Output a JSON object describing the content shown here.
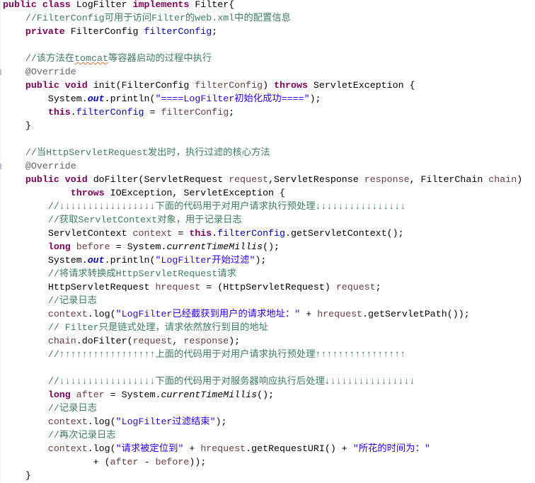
{
  "code": {
    "lines": [
      [
        [
          "public class ",
          "k"
        ],
        [
          "LogFilter ",
          "p"
        ],
        [
          "implements ",
          "k"
        ],
        [
          "Filter{",
          "p"
        ]
      ],
      [
        [
          "    ",
          "p"
        ],
        [
          "//FilterConfig可用于访问Filter的web.xml中的配置信息",
          "c"
        ]
      ],
      [
        [
          "    ",
          "p"
        ],
        [
          "private ",
          "k"
        ],
        [
          "FilterConfig ",
          "p"
        ],
        [
          "filterConfig",
          "f"
        ],
        [
          ";",
          "p"
        ]
      ],
      [],
      [
        [
          "    ",
          "p"
        ],
        [
          "//该方法在",
          "c"
        ],
        [
          "tomcat",
          "cu"
        ],
        [
          "等容器启动的过程中执行",
          "c"
        ]
      ],
      [
        [
          "    ",
          "p"
        ],
        [
          "@Override",
          "a"
        ]
      ],
      [
        [
          "    ",
          "p"
        ],
        [
          "public void ",
          "k"
        ],
        [
          "init(FilterConfig ",
          "p"
        ],
        [
          "filterConfig",
          "v"
        ],
        [
          ") ",
          "p"
        ],
        [
          "throws ",
          "k"
        ],
        [
          "ServletException {",
          "p"
        ]
      ],
      [
        [
          "        System.",
          "p"
        ],
        [
          "out",
          "o"
        ],
        [
          ".println(",
          "p"
        ],
        [
          "\"====LogFilter初始化成功====\"",
          "s"
        ],
        [
          ");",
          "p"
        ]
      ],
      [
        [
          "        ",
          "p"
        ],
        [
          "this",
          "k"
        ],
        [
          ".",
          "p"
        ],
        [
          "filterConfig",
          "f"
        ],
        [
          " = ",
          "p"
        ],
        [
          "filterConfig",
          "v"
        ],
        [
          ";",
          "p"
        ]
      ],
      [
        [
          "    }",
          "p"
        ]
      ],
      [],
      [
        [
          "    ",
          "p"
        ],
        [
          "//当HttpServletRequest发出时，执行过滤的核心方法",
          "c"
        ]
      ],
      [
        [
          "    ",
          "p"
        ],
        [
          "@Override",
          "a"
        ]
      ],
      [
        [
          "    ",
          "p"
        ],
        [
          "public void ",
          "k"
        ],
        [
          "doFilter(ServletRequest ",
          "p"
        ],
        [
          "request",
          "v"
        ],
        [
          ",ServletResponse ",
          "p"
        ],
        [
          "response",
          "v"
        ],
        [
          ", FilterChain ",
          "p"
        ],
        [
          "chain",
          "v"
        ],
        [
          ")",
          "p"
        ]
      ],
      [
        [
          "            ",
          "p"
        ],
        [
          "throws ",
          "k"
        ],
        [
          "IOException, ServletException {",
          "p"
        ]
      ],
      [
        [
          "        ",
          "p"
        ],
        [
          "//↓↓↓↓↓↓↓↓↓↓↓↓↓↓↓↓↓下面的代码用于对用户请求执行预处理↓↓↓↓↓↓↓↓↓↓↓↓↓↓↓↓",
          "c"
        ]
      ],
      [
        [
          "        ",
          "p"
        ],
        [
          "//获取ServletContext对象，用于记录日志",
          "c"
        ]
      ],
      [
        [
          "        ServletContext ",
          "p"
        ],
        [
          "context",
          "v"
        ],
        [
          " = ",
          "p"
        ],
        [
          "this",
          "k"
        ],
        [
          ".",
          "p"
        ],
        [
          "filterConfig",
          "f"
        ],
        [
          ".getServletContext();",
          "p"
        ]
      ],
      [
        [
          "        ",
          "p"
        ],
        [
          "long ",
          "k"
        ],
        [
          "before",
          "v"
        ],
        [
          " = System.",
          "p"
        ],
        [
          "currentTimeMillis",
          "i"
        ],
        [
          "();",
          "p"
        ]
      ],
      [
        [
          "        System.",
          "p"
        ],
        [
          "out",
          "o"
        ],
        [
          ".println(",
          "p"
        ],
        [
          "\"LogFilter开始过滤\"",
          "s"
        ],
        [
          ");",
          "p"
        ]
      ],
      [
        [
          "        ",
          "p"
        ],
        [
          "//将请求转换成HttpServletRequest请求",
          "c"
        ]
      ],
      [
        [
          "        HttpServletRequest ",
          "p"
        ],
        [
          "hrequest",
          "v"
        ],
        [
          " = (HttpServletRequest) ",
          "p"
        ],
        [
          "request",
          "v"
        ],
        [
          ";",
          "p"
        ]
      ],
      [
        [
          "        ",
          "p"
        ],
        [
          "//记录日志",
          "c"
        ]
      ],
      [
        [
          "        ",
          "p"
        ],
        [
          "context",
          "v"
        ],
        [
          ".log(",
          "p"
        ],
        [
          "\"LogFilter已经截获到用户的请求地址：\"",
          "s"
        ],
        [
          " + ",
          "p"
        ],
        [
          "hrequest",
          "v"
        ],
        [
          ".getServletPath());",
          "p"
        ]
      ],
      [
        [
          "        ",
          "p"
        ],
        [
          "// Filter只是链式处理，请求依然放行到目的地址",
          "c"
        ]
      ],
      [
        [
          "        ",
          "p"
        ],
        [
          "chain",
          "v"
        ],
        [
          ".doFilter(",
          "p"
        ],
        [
          "request",
          "v"
        ],
        [
          ", ",
          "p"
        ],
        [
          "response",
          "v"
        ],
        [
          ");",
          "p"
        ]
      ],
      [
        [
          "        ",
          "p"
        ],
        [
          "//↑↑↑↑↑↑↑↑↑↑↑↑↑↑↑↑↑上面的代码用于对用户请求执行预处理↑↑↑↑↑↑↑↑↑↑↑↑↑↑↑↑",
          "c"
        ]
      ],
      [],
      [
        [
          "        ",
          "p"
        ],
        [
          "//↓↓↓↓↓↓↓↓↓↓↓↓↓↓↓↓↓下面的代码用于对服务器响应执行后处理↓↓↓↓↓↓↓↓↓↓↓↓↓↓↓↓",
          "c"
        ]
      ],
      [
        [
          "        ",
          "p"
        ],
        [
          "long ",
          "k"
        ],
        [
          "after",
          "v"
        ],
        [
          " = System.",
          "p"
        ],
        [
          "currentTimeMillis",
          "i"
        ],
        [
          "();",
          "p"
        ]
      ],
      [
        [
          "        ",
          "p"
        ],
        [
          "//记录日志",
          "c"
        ]
      ],
      [
        [
          "        ",
          "p"
        ],
        [
          "context",
          "v"
        ],
        [
          ".log(",
          "p"
        ],
        [
          "\"LogFilter过滤结束\"",
          "s"
        ],
        [
          ");",
          "p"
        ]
      ],
      [
        [
          "        ",
          "p"
        ],
        [
          "//再次记录日志",
          "c"
        ]
      ],
      [
        [
          "        ",
          "p"
        ],
        [
          "context",
          "v"
        ],
        [
          ".log(",
          "p"
        ],
        [
          "\"请求被定位到\"",
          "s"
        ],
        [
          " + ",
          "p"
        ],
        [
          "hrequest",
          "v"
        ],
        [
          ".getRequestURI() + ",
          "p"
        ],
        [
          "\"所花的时间为：\"",
          "s"
        ]
      ],
      [
        [
          "                + (",
          "p"
        ],
        [
          "after",
          "v"
        ],
        [
          " - ",
          "p"
        ],
        [
          "before",
          "v"
        ],
        [
          "));",
          "p"
        ]
      ],
      [
        [
          "    }",
          "p"
        ]
      ]
    ]
  },
  "colors": {
    "keyword": "#7f0055",
    "comment": "#3f7f5f",
    "string": "#2a00ff",
    "field": "#0000c0",
    "local_variable": "#6a3e3e",
    "annotation": "#646464"
  }
}
